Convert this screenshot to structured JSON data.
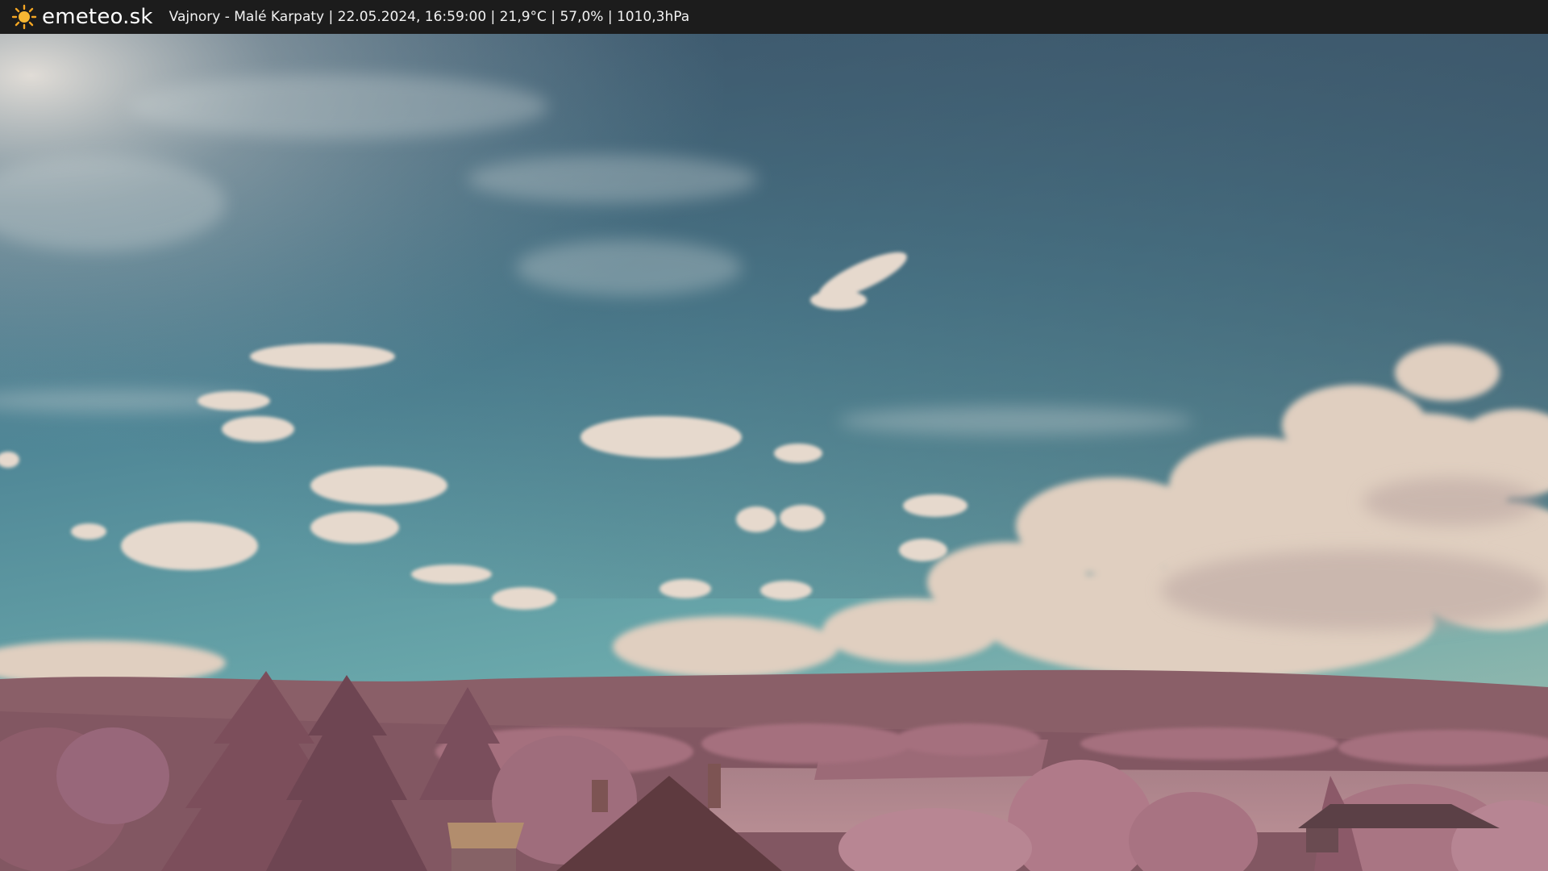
{
  "header": {
    "logo_text": "emeteo.sk",
    "logo_icon": "sun-icon",
    "info": "Vajnory - Malé Karpaty | 22.05.2024, 16:59:00 | 21,9°C | 57,0% | 1010,3hPa"
  },
  "colors": {
    "bar_background": "#1c1c1c",
    "sun": "#f5a623",
    "sky_top": "#3e5a70",
    "sky_bottom": "#5f9fa6",
    "hills": "#8c5e66",
    "foliage": "#b07884"
  }
}
